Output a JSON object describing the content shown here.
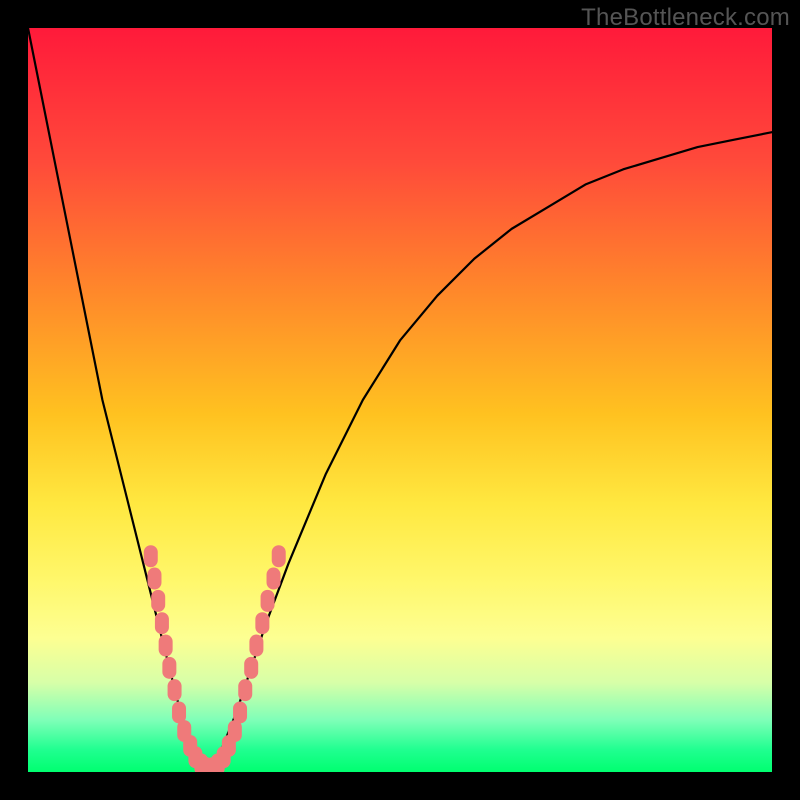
{
  "watermark": "TheBottleneck.com",
  "chart_data": {
    "type": "line",
    "title": "",
    "xlabel": "",
    "ylabel": "",
    "xlim": [
      0,
      100
    ],
    "ylim": [
      0,
      100
    ],
    "grid": false,
    "legend": false,
    "background": {
      "gradient": "red-to-green vertical",
      "stops": [
        {
          "pos": 0,
          "color": "#ff1a3a"
        },
        {
          "pos": 50,
          "color": "#ffc220"
        },
        {
          "pos": 80,
          "color": "#fff76a"
        },
        {
          "pos": 100,
          "color": "#00ff70"
        }
      ]
    },
    "series": [
      {
        "name": "bottleneck-curve",
        "color": "#000000",
        "x": [
          0,
          2,
          4,
          6,
          8,
          10,
          12,
          14,
          16,
          18,
          19,
          20,
          21,
          22,
          23,
          24,
          25,
          26,
          28,
          30,
          32,
          35,
          40,
          45,
          50,
          55,
          60,
          65,
          70,
          75,
          80,
          85,
          90,
          95,
          100
        ],
        "y": [
          100,
          90,
          80,
          70,
          60,
          50,
          42,
          34,
          26,
          18,
          14,
          10,
          6,
          3,
          1,
          0,
          1,
          3,
          8,
          14,
          20,
          28,
          40,
          50,
          58,
          64,
          69,
          73,
          76,
          79,
          81,
          82.5,
          84,
          85,
          86
        ]
      }
    ],
    "markers": {
      "name": "scatter-points",
      "color": "#ef7a7a",
      "shape": "rounded-rect",
      "points": [
        {
          "x": 16.5,
          "y": 29
        },
        {
          "x": 17.0,
          "y": 26
        },
        {
          "x": 17.5,
          "y": 23
        },
        {
          "x": 18.0,
          "y": 20
        },
        {
          "x": 18.5,
          "y": 17
        },
        {
          "x": 19.0,
          "y": 14
        },
        {
          "x": 19.7,
          "y": 11
        },
        {
          "x": 20.3,
          "y": 8
        },
        {
          "x": 21.0,
          "y": 5.5
        },
        {
          "x": 21.8,
          "y": 3.5
        },
        {
          "x": 22.5,
          "y": 2
        },
        {
          "x": 23.3,
          "y": 1
        },
        {
          "x": 24.0,
          "y": 0.5
        },
        {
          "x": 24.8,
          "y": 0.5
        },
        {
          "x": 25.5,
          "y": 1
        },
        {
          "x": 26.3,
          "y": 2
        },
        {
          "x": 27.0,
          "y": 3.5
        },
        {
          "x": 27.8,
          "y": 5.5
        },
        {
          "x": 28.5,
          "y": 8
        },
        {
          "x": 29.2,
          "y": 11
        },
        {
          "x": 30.0,
          "y": 14
        },
        {
          "x": 30.7,
          "y": 17
        },
        {
          "x": 31.5,
          "y": 20
        },
        {
          "x": 32.2,
          "y": 23
        },
        {
          "x": 33.0,
          "y": 26
        },
        {
          "x": 33.7,
          "y": 29
        }
      ]
    }
  }
}
